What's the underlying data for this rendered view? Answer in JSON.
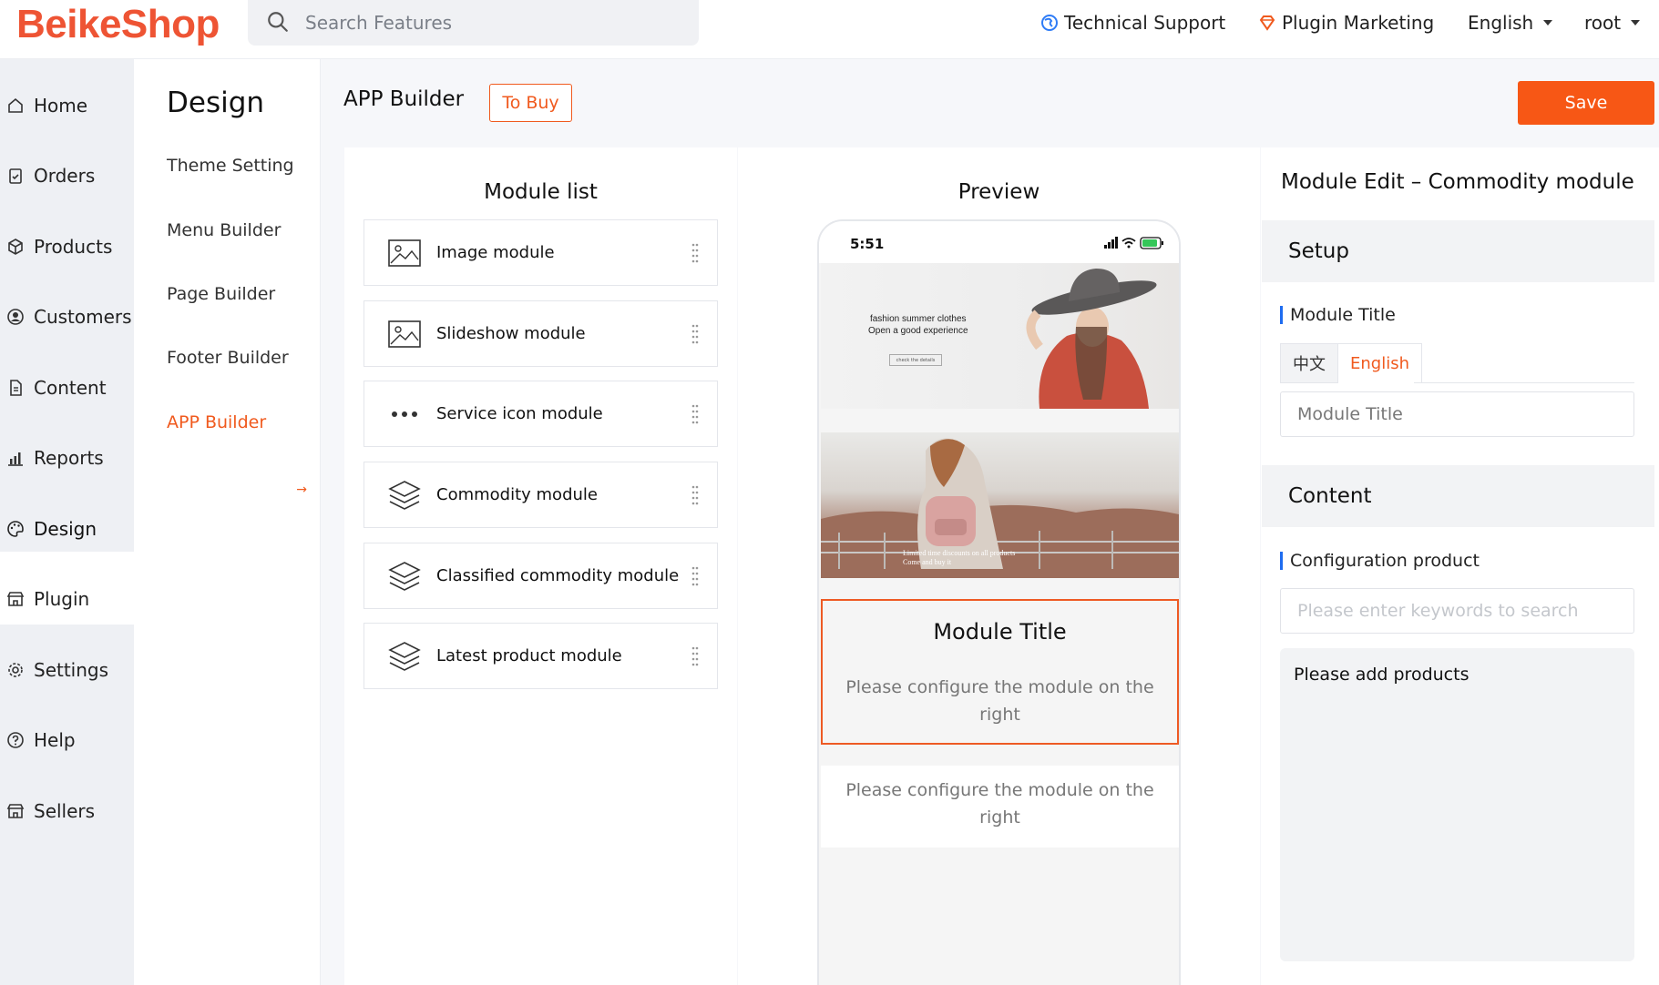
{
  "header": {
    "logo": "BeikeShop",
    "search_placeholder": "Search Features",
    "technical_support": "Technical Support",
    "plugin_marketing": "Plugin Marketing",
    "language": "English",
    "user": "root"
  },
  "leftnav": {
    "items": [
      {
        "label": "Home",
        "icon": "home-icon"
      },
      {
        "label": "Orders",
        "icon": "clipboard-icon"
      },
      {
        "label": "Products",
        "icon": "box-icon"
      },
      {
        "label": "Customers",
        "icon": "user-circle-icon"
      },
      {
        "label": "Content",
        "icon": "document-icon"
      },
      {
        "label": "Reports",
        "icon": "bar-chart-icon"
      },
      {
        "label": "Design",
        "icon": "palette-icon"
      },
      {
        "label": "Plugin",
        "icon": "store-icon"
      },
      {
        "label": "Settings",
        "icon": "gear-icon"
      },
      {
        "label": "Help",
        "icon": "help-icon"
      },
      {
        "label": "Sellers",
        "icon": "store-icon"
      }
    ],
    "active": "Design"
  },
  "subnav": {
    "title": "Design",
    "items": [
      "Theme Setting",
      "Menu Builder",
      "Page Builder",
      "Footer Builder",
      "APP Builder"
    ],
    "active": "APP Builder",
    "arrow": "→"
  },
  "main": {
    "title": "APP Builder",
    "to_buy": "To Buy",
    "save": "Save"
  },
  "module_list": {
    "title": "Module list",
    "items": [
      {
        "label": "Image module",
        "icon": "image-icon"
      },
      {
        "label": "Slideshow module",
        "icon": "image-icon"
      },
      {
        "label": "Service icon module",
        "icon": "dots-icon"
      },
      {
        "label": "Commodity module",
        "icon": "layers-icon"
      },
      {
        "label": "Classified commodity module",
        "icon": "layers-icon"
      },
      {
        "label": "Latest product module",
        "icon": "layers-icon"
      }
    ]
  },
  "preview": {
    "title": "Preview",
    "time": "5:51",
    "banner1_line1": "fashion summer clothes",
    "banner1_line2": "Open a good experience",
    "banner1_button": "check the details",
    "banner2_line1": "Limited time discounts on all products",
    "banner2_line2": "Come and buy it",
    "module_title": "Module Title",
    "module_desc": "Please configure the module on the right",
    "module2_desc": "Please configure the module on the right"
  },
  "editor": {
    "title": "Module Edit – Commodity module",
    "setup": "Setup",
    "module_title_label": "Module Title",
    "lang_zh": "中文",
    "lang_en": "English",
    "module_title_placeholder": "Module Title",
    "content": "Content",
    "config_label": "Configuration product",
    "search_placeholder": "Please enter keywords to search",
    "add_products": "Please add products"
  },
  "colors": {
    "brand": "#ee5434",
    "accent": "#f05a1e",
    "save_bg": "#f75715",
    "label_bar": "#1e6cf0"
  }
}
